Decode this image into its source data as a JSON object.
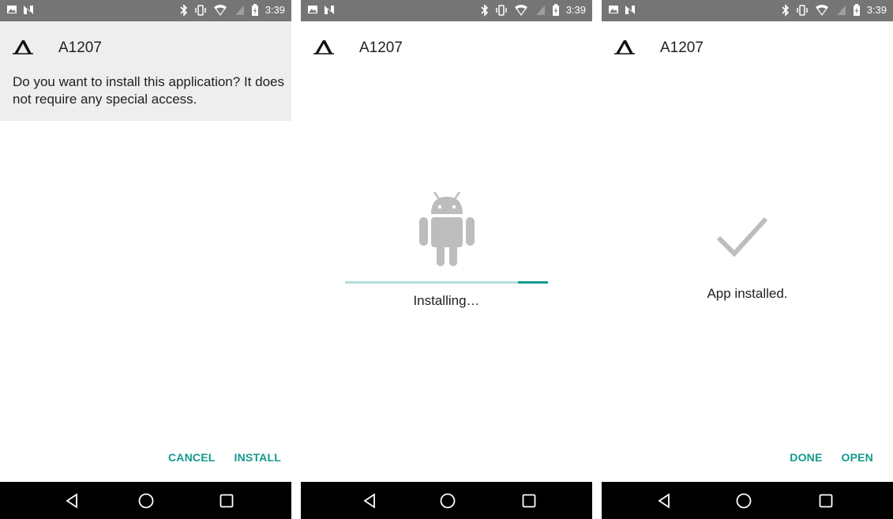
{
  "status_bar": {
    "time": "3:39"
  },
  "app": {
    "name": "A1207"
  },
  "screens": [
    {
      "prompt": "Do you want to install this application? It does not require any special access.",
      "actions": {
        "cancel": "CANCEL",
        "install": "INSTALL"
      }
    },
    {
      "status": "Installing…",
      "progress": 0.15
    },
    {
      "status": "App installed.",
      "actions": {
        "done": "DONE",
        "open": "OPEN"
      }
    }
  ],
  "colors": {
    "accent": "#139a8c",
    "status_bar": "#757575",
    "nav_bar": "#000000",
    "dialog_bg": "#eeeeee"
  },
  "icons": [
    "image-icon",
    "n-icon",
    "bluetooth-icon",
    "vibrate-icon",
    "wifi-icon",
    "no-sim-icon",
    "battery-icon",
    "back-icon",
    "home-icon",
    "recents-icon",
    "android-icon",
    "checkmark-icon",
    "app-logo-icon"
  ]
}
